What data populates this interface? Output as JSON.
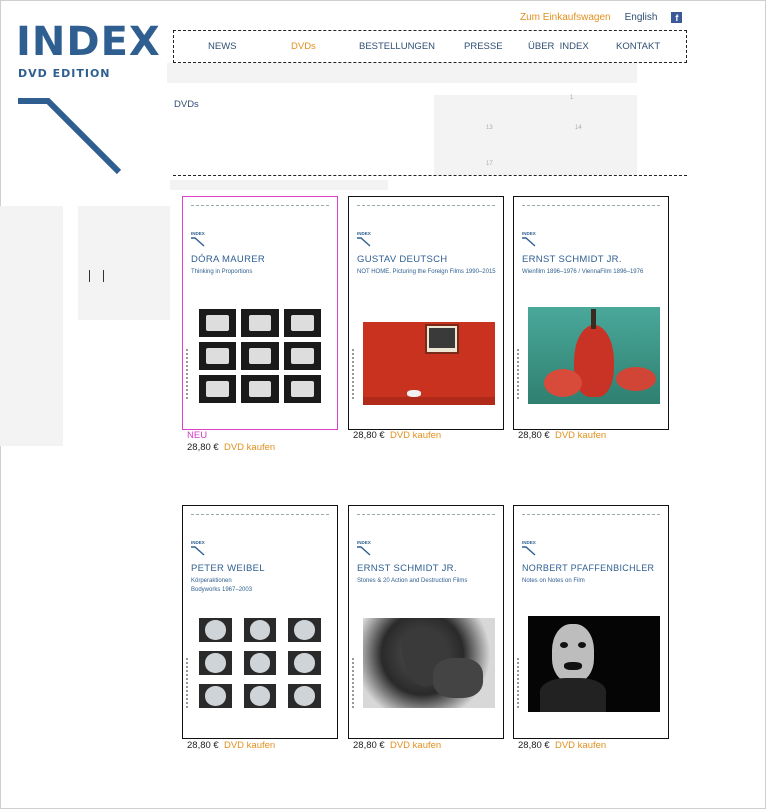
{
  "brand": {
    "title": "INDEX",
    "subtitle": "DVD EDITION"
  },
  "top": {
    "cart": "Zum Einkaufswagen",
    "language": "English",
    "facebook": "f"
  },
  "nav": [
    {
      "label": "NEWS",
      "active": false
    },
    {
      "label": "DVDs",
      "active": true
    },
    {
      "label": "BESTELLUNGEN",
      "active": false
    },
    {
      "label": "PRESSE",
      "active": false
    },
    {
      "label": "ÜBER  INDEX",
      "active": false
    },
    {
      "label": "KONTAKT",
      "active": false
    }
  ],
  "breadcrumb": "DVDs",
  "ghost_numbers": [
    "1",
    "13",
    "14",
    "17"
  ],
  "products": [
    {
      "artist": "DÓRA MAURER",
      "subtitle": "Thinking in Proportions",
      "badge": "NEU",
      "price": "28,80 €",
      "buy": "DVD kaufen",
      "cover_brand": "INDEX"
    },
    {
      "artist": "GUSTAV DEUTSCH",
      "subtitle": "NOT HOME. Picturing the Foreign Films 1990–2015",
      "price": "28,80 €",
      "buy": "DVD kaufen",
      "cover_brand": "INDEX"
    },
    {
      "artist": "ERNST SCHMIDT JR.",
      "subtitle": "Wienfilm 1896–1976 / ViennaFilm 1896–1976",
      "price": "28,80 €",
      "buy": "DVD kaufen",
      "cover_brand": "INDEX"
    },
    {
      "artist": "PETER WEIBEL",
      "subtitle": "Körperaktionen Bodyworks 1967–2003",
      "price": "28,80 €",
      "buy": "DVD kaufen",
      "cover_brand": "INDEX"
    },
    {
      "artist": "ERNST SCHMIDT JR.",
      "subtitle": "Stones & 20 Action and Destruction Films",
      "price": "28,80 €",
      "buy": "DVD kaufen",
      "cover_brand": "INDEX"
    },
    {
      "artist": "NORBERT PFAFFENBICHLER",
      "subtitle": "Notes on Notes on Film",
      "price": "28,80 €",
      "buy": "DVD kaufen",
      "cover_brand": "INDEX"
    }
  ],
  "colors": {
    "brand_blue": "#2f5f91",
    "accent_orange": "#e2901e",
    "new_pink": "#d23bc0"
  }
}
